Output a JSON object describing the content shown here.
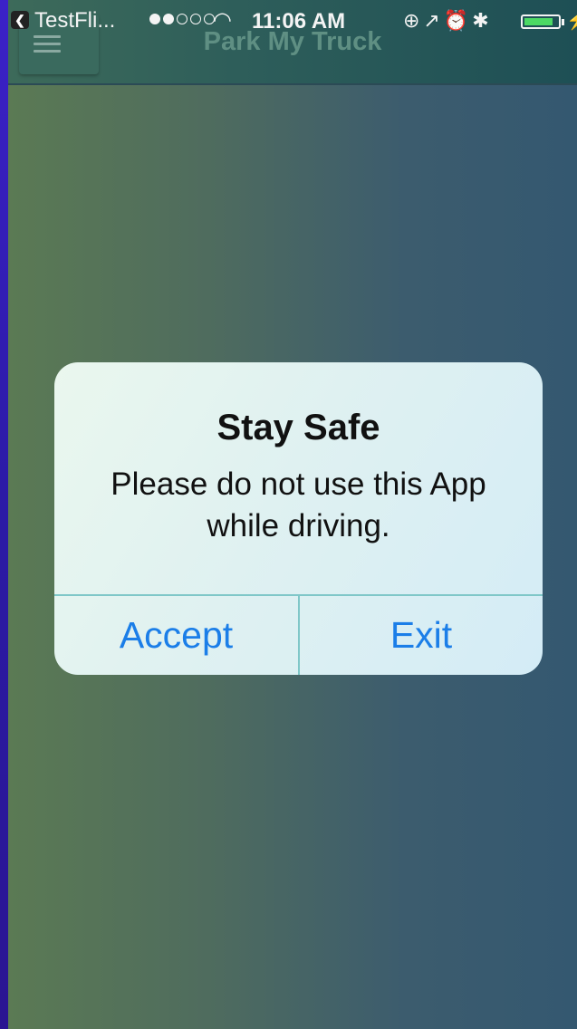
{
  "status_bar": {
    "back_app": "TestFli...",
    "time": "11:06 AM",
    "signal_filled": 2,
    "signal_total": 5,
    "battery_level": 0.85
  },
  "navbar": {
    "title": "Park My Truck",
    "menu_icon": "hamburger-icon"
  },
  "alert": {
    "title": "Stay Safe",
    "message": "Please do not use this App while driving.",
    "buttons": {
      "accept": "Accept",
      "exit": "Exit"
    }
  },
  "colors": {
    "button_text": "#1b7ee8",
    "battery_fill": "#4cd964"
  }
}
